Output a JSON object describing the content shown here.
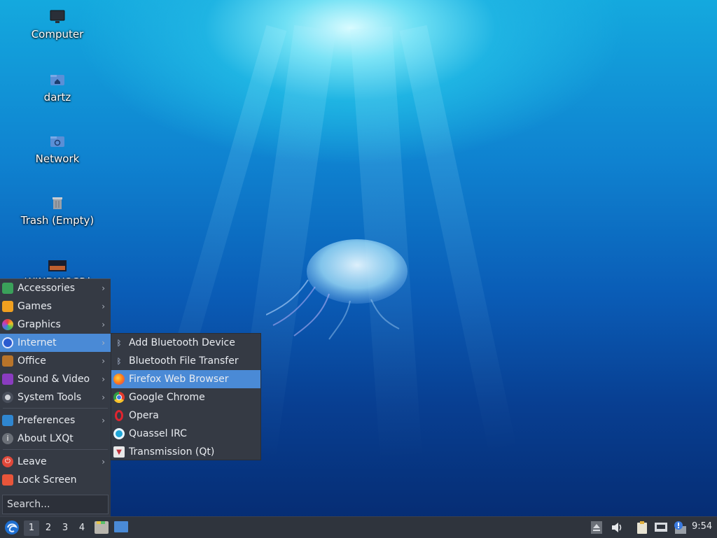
{
  "desktop": {
    "icons": [
      {
        "label": "Computer",
        "icon": "monitor-icon"
      },
      {
        "label": "dartz",
        "icon": "home-folder-icon"
      },
      {
        "label": "Network",
        "icon": "network-folder-icon"
      },
      {
        "label": "Trash (Empty)",
        "icon": "trash-icon"
      },
      {
        "label": "WINDWOSP.i",
        "icon": "image-file-icon"
      }
    ]
  },
  "menu": {
    "items": [
      {
        "label": "Accessories",
        "icon": "accessories-icon",
        "submenu": true
      },
      {
        "label": "Games",
        "icon": "games-icon",
        "submenu": true
      },
      {
        "label": "Graphics",
        "icon": "graphics-icon",
        "submenu": true
      },
      {
        "label": "Internet",
        "icon": "internet-icon",
        "submenu": true,
        "active": true
      },
      {
        "label": "Office",
        "icon": "office-icon",
        "submenu": true
      },
      {
        "label": "Sound & Video",
        "icon": "sound-video-icon",
        "submenu": true
      },
      {
        "label": "System Tools",
        "icon": "system-tools-icon",
        "submenu": true
      },
      {
        "label": "Preferences",
        "icon": "preferences-icon",
        "submenu": true
      },
      {
        "label": "About LXQt",
        "icon": "info-icon",
        "submenu": false
      },
      {
        "label": "Leave",
        "icon": "power-icon",
        "submenu": true
      },
      {
        "label": "Lock Screen",
        "icon": "lock-icon",
        "submenu": false
      }
    ],
    "search_placeholder": "Search..."
  },
  "submenu": {
    "items": [
      {
        "label": "Add Bluetooth Device",
        "icon": "bluetooth-icon"
      },
      {
        "label": "Bluetooth File Transfer",
        "icon": "bluetooth-icon"
      },
      {
        "label": "Firefox Web Browser",
        "icon": "firefox-icon",
        "highlighted": true
      },
      {
        "label": "Google Chrome",
        "icon": "chrome-icon"
      },
      {
        "label": "Opera",
        "icon": "opera-icon"
      },
      {
        "label": "Quassel IRC",
        "icon": "quassel-icon"
      },
      {
        "label": "Transmission (Qt)",
        "icon": "transmission-icon"
      }
    ]
  },
  "taskbar": {
    "workspaces": [
      "1",
      "2",
      "3",
      "4"
    ],
    "active_workspace": "1",
    "clock": "9:54"
  },
  "colors": {
    "menu_bg": "#353a44",
    "highlight": "#4a8ad6",
    "taskbar_bg": "#2f343d"
  }
}
